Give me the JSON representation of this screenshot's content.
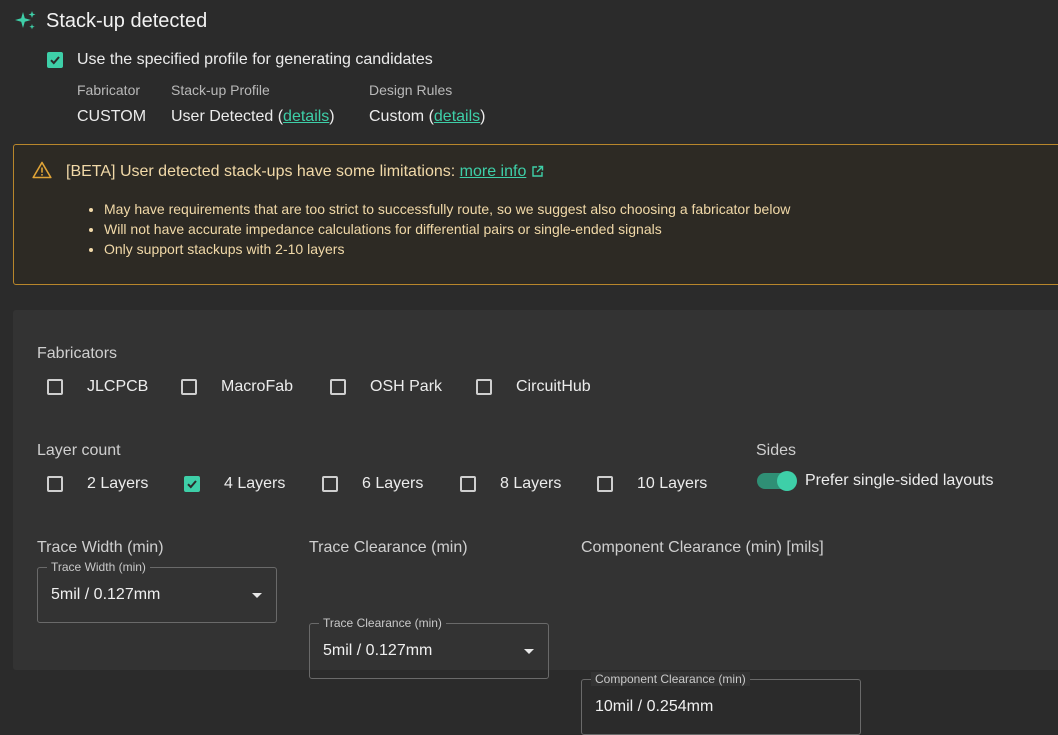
{
  "header": {
    "title": "Stack-up detected",
    "icon": "sparkle-icon"
  },
  "profile": {
    "use_profile_label": "Use the specified profile for generating candidates",
    "use_profile_checked": true,
    "columns": [
      {
        "header": "Fabricator",
        "value": "CUSTOM"
      },
      {
        "header": "Stack-up Profile",
        "value_prefix": "User Detected (",
        "link": "details",
        "value_suffix": ")"
      },
      {
        "header": "Design Rules",
        "value_prefix": "Custom (",
        "link": "details",
        "value_suffix": ")"
      }
    ]
  },
  "beta": {
    "message": "[BETA] User detected stack-ups have some limitations:",
    "link": "more info",
    "bullets": [
      "May have requirements that are too strict to successfully route, so we suggest also choosing a fabricator below",
      "Will not have accurate impedance calculations for differential pairs or single-ended signals",
      "Only support stackups with 2-10 layers"
    ]
  },
  "fabricators": {
    "label": "Fabricators",
    "options": [
      {
        "label": "JLCPCB",
        "checked": false
      },
      {
        "label": "MacroFab",
        "checked": false
      },
      {
        "label": "OSH Park",
        "checked": false
      },
      {
        "label": "CircuitHub",
        "checked": false
      }
    ]
  },
  "layers": {
    "label": "Layer count",
    "options": [
      {
        "label": "2 Layers",
        "checked": false
      },
      {
        "label": "4 Layers",
        "checked": true
      },
      {
        "label": "6 Layers",
        "checked": false
      },
      {
        "label": "8 Layers",
        "checked": false
      },
      {
        "label": "10 Layers",
        "checked": false
      }
    ]
  },
  "sides": {
    "label": "Sides",
    "toggle_label": "Prefer single-sided layouts",
    "toggle_on": true
  },
  "fields": [
    {
      "title": "Trace Width (min)",
      "legend": "Trace Width (min)",
      "value": "5mil / 0.127mm",
      "dropdown": true
    },
    {
      "title": "Trace Clearance (min)",
      "legend": "Trace Clearance (min)",
      "value": "5mil / 0.127mm",
      "dropdown": true
    },
    {
      "title": "Component Clearance (min) [mils]",
      "legend": "Component Clearance (min)",
      "value": "10mil / 0.254mm",
      "dropdown": false
    }
  ],
  "colors": {
    "accent": "#3ecfa8",
    "warning_border": "#b8862b",
    "warning_text": "#f1d9a8"
  }
}
